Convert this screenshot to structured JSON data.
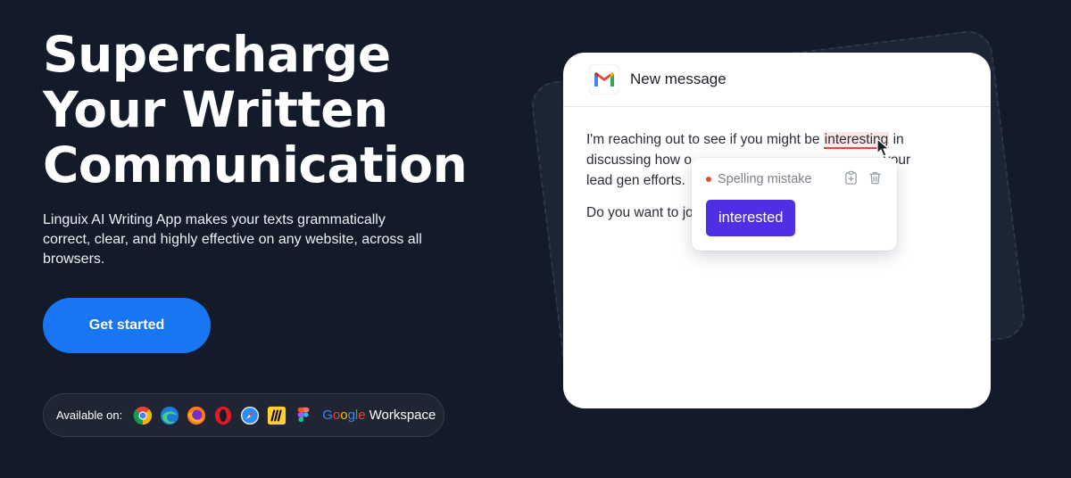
{
  "hero": {
    "title_lines": [
      "Supercharge",
      "Your Written",
      "Communication"
    ],
    "subtitle": "Linguix AI Writing App makes your texts grammatically correct, clear, and highly effective on any website, across all browsers.",
    "cta_label": "Get started"
  },
  "available": {
    "label": "Available on:",
    "icons": [
      "chrome-icon",
      "edge-icon",
      "firefox-icon",
      "opera-icon",
      "safari-icon",
      "miro-icon",
      "figma-icon"
    ],
    "google": [
      "G",
      "o",
      "o",
      "g",
      "l",
      "e"
    ],
    "workspace": "Workspace"
  },
  "mail": {
    "title": "New message",
    "line1_before": "I'm reaching out to see if you might be ",
    "misspelled_word": "interesting",
    "line1_after": " in",
    "line2": "discussing how o",
    "line2_tail": "your",
    "line3": "lead gen efforts.",
    "para2": "Do you want to jo"
  },
  "popover": {
    "issue_label": "Spelling mistake",
    "suggestion": "interested"
  },
  "colors": {
    "background": "#131a2a",
    "cta": "#1976f3",
    "suggestion": "#4f2ee6",
    "error": "#e8453c"
  }
}
